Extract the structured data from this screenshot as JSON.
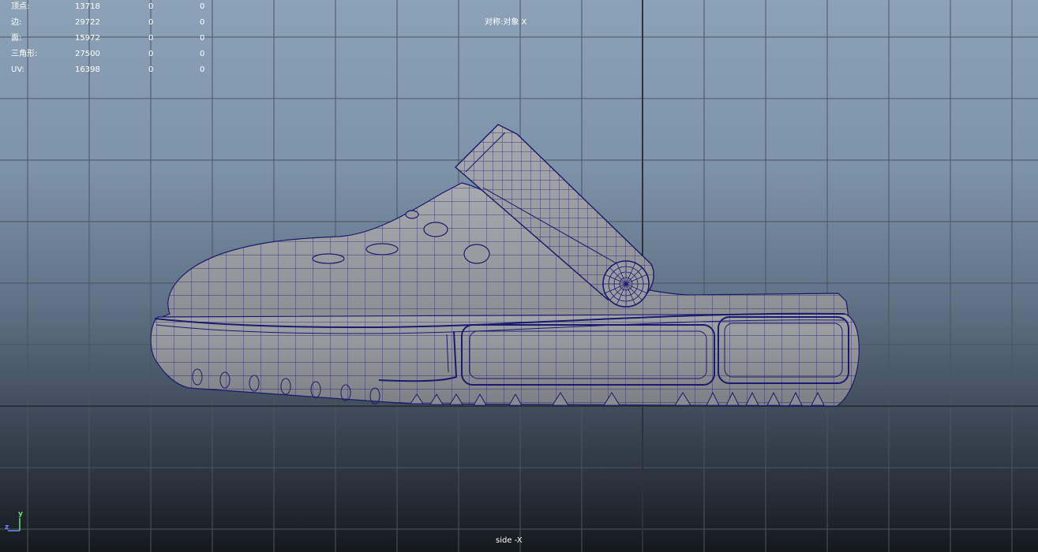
{
  "viewport": {
    "camera_label": "side -X",
    "symmetry_label": "对称:对象 X",
    "stats": [
      {
        "label": "顶点:",
        "values": [
          "13718",
          "0",
          "0"
        ]
      },
      {
        "label": "边:",
        "values": [
          "29722",
          "0",
          "0"
        ]
      },
      {
        "label": "面:",
        "values": [
          "15972",
          "0",
          "0"
        ]
      },
      {
        "label": "三角形:",
        "values": [
          "27500",
          "0",
          "0"
        ]
      },
      {
        "label": "UV:",
        "values": [
          "16398",
          "0",
          "0"
        ]
      }
    ],
    "axis": {
      "y_label": "y",
      "z_label": "z"
    },
    "colors": {
      "wire": "#1a1a6e",
      "surface": "#9a9ba0",
      "grid": "#4a5560",
      "axis_y": "#6fe36f",
      "axis_z": "#6f8bff"
    }
  }
}
